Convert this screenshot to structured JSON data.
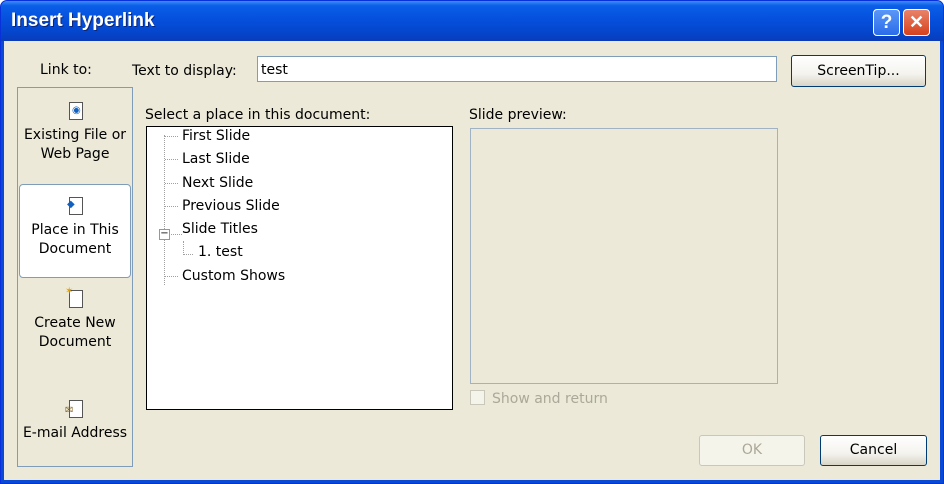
{
  "window": {
    "title": "Insert Hyperlink",
    "help_glyph": "?",
    "close_glyph": "✕"
  },
  "link_to": {
    "label": "Link to:",
    "places": [
      {
        "line1": "Existing File or",
        "line2": "Web Page",
        "icon": "existing-file-icon"
      },
      {
        "line1": "Place in This",
        "line2": "Document",
        "icon": "place-in-document-icon",
        "selected": true
      },
      {
        "line1": "Create New",
        "line2": "Document",
        "icon": "new-document-icon"
      },
      {
        "line1": "E-mail Address",
        "line2": "",
        "icon": "email-icon"
      }
    ]
  },
  "text_to_display": {
    "label": "Text to display:",
    "value": "test"
  },
  "screentip_label": "ScreenTip...",
  "select_place": {
    "label": "Select a place in this document:",
    "items": [
      "First Slide",
      "Last Slide",
      "Next Slide",
      "Previous Slide",
      "Slide Titles",
      "1. test",
      "Custom Shows"
    ],
    "expander": "−"
  },
  "slide_preview": {
    "label": "Slide preview:"
  },
  "show_and_return": {
    "label": "Show and return",
    "checked": false,
    "enabled": false
  },
  "buttons": {
    "ok": "OK",
    "cancel": "Cancel"
  }
}
